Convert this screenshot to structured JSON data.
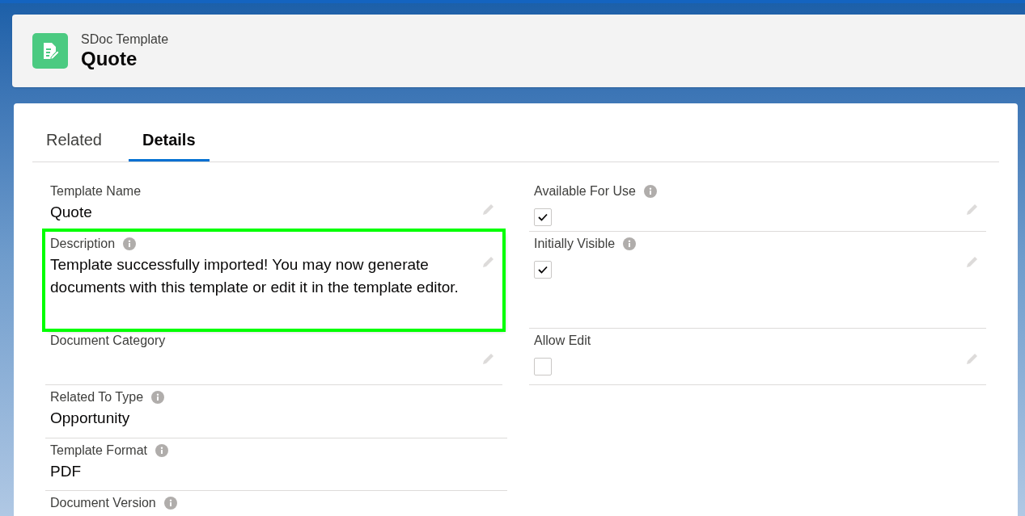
{
  "header": {
    "object_type": "SDoc Template",
    "title": "Quote"
  },
  "tabs": [
    {
      "label": "Related",
      "selected": false
    },
    {
      "label": "Details",
      "selected": true
    }
  ],
  "left_fields": [
    {
      "label": "Template Name",
      "kind": "text",
      "info": false,
      "highlighted": false,
      "value": "Quote"
    },
    {
      "label": "Description",
      "kind": "text",
      "info": true,
      "highlighted": true,
      "value": "Template successfully imported! You may now generate documents with this template or edit it in the template editor."
    },
    {
      "label": "Document Category",
      "kind": "text",
      "info": false,
      "highlighted": false
    },
    {
      "label": "Related To Type",
      "kind": "text",
      "info": true,
      "highlighted": false,
      "value": "Opportunity"
    },
    {
      "label": "Template Format",
      "kind": "text",
      "info": true,
      "highlighted": false,
      "value": "PDF"
    },
    {
      "label": "Document Version",
      "kind": "text",
      "info": true,
      "highlighted": false
    }
  ],
  "right_fields": [
    {
      "label": "Available For Use",
      "kind": "checkbox",
      "info": true,
      "checked": true
    },
    {
      "label": "Initially Visible",
      "kind": "checkbox",
      "info": true,
      "checked": true
    },
    {
      "label": "Allow Edit",
      "kind": "checkbox",
      "info": false,
      "checked": false
    }
  ]
}
